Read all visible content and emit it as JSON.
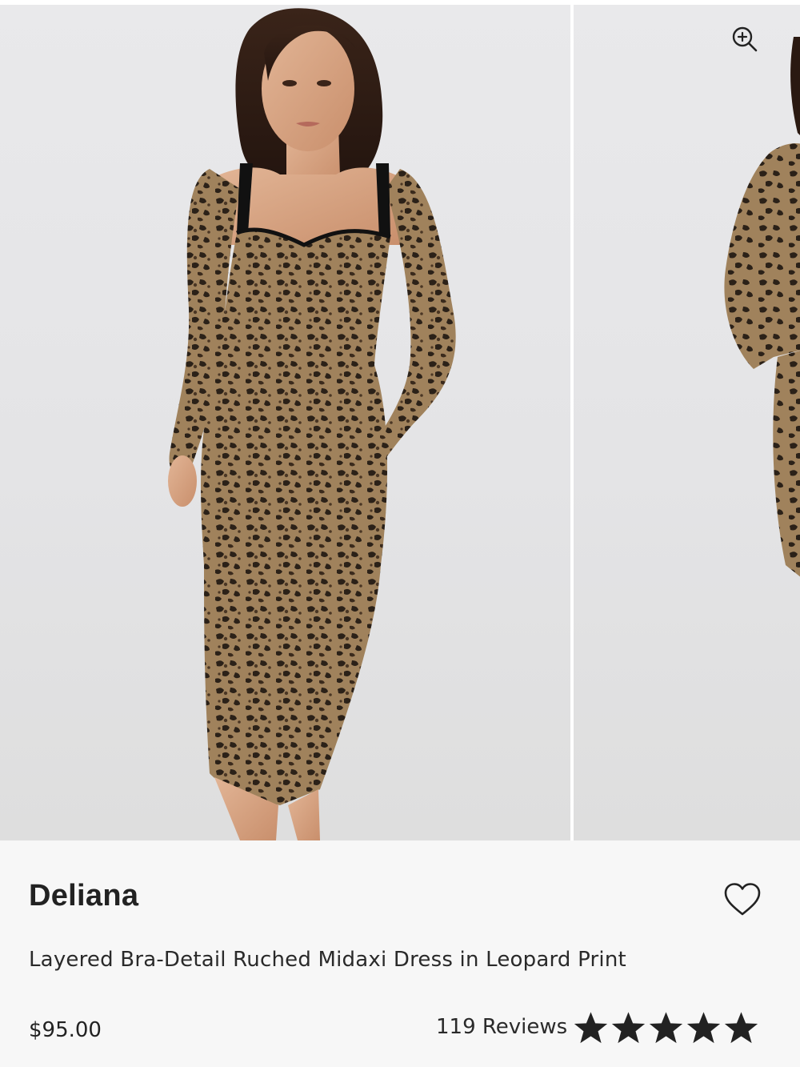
{
  "gallery": {
    "images": [
      {
        "alt": "model front view, leopard print dress"
      },
      {
        "alt": "model back view, leopard print dress"
      }
    ],
    "zoom_icon": "zoom-in-icon"
  },
  "product": {
    "brand": "Deliana",
    "title": "Layered Bra-Detail Ruched Midaxi Dress in Leopard Print",
    "price": "$95.00",
    "reviews_label": "119 Reviews",
    "rating": 5,
    "rating_max": 5,
    "wishlist_icon": "heart-icon"
  },
  "colors": {
    "text": "#222222",
    "star": "#222222",
    "background": "#f7f7f7",
    "photo_background": "#e6e6e8",
    "leopard_base": "#9b7d57",
    "leopard_spot": "#2b2118"
  }
}
